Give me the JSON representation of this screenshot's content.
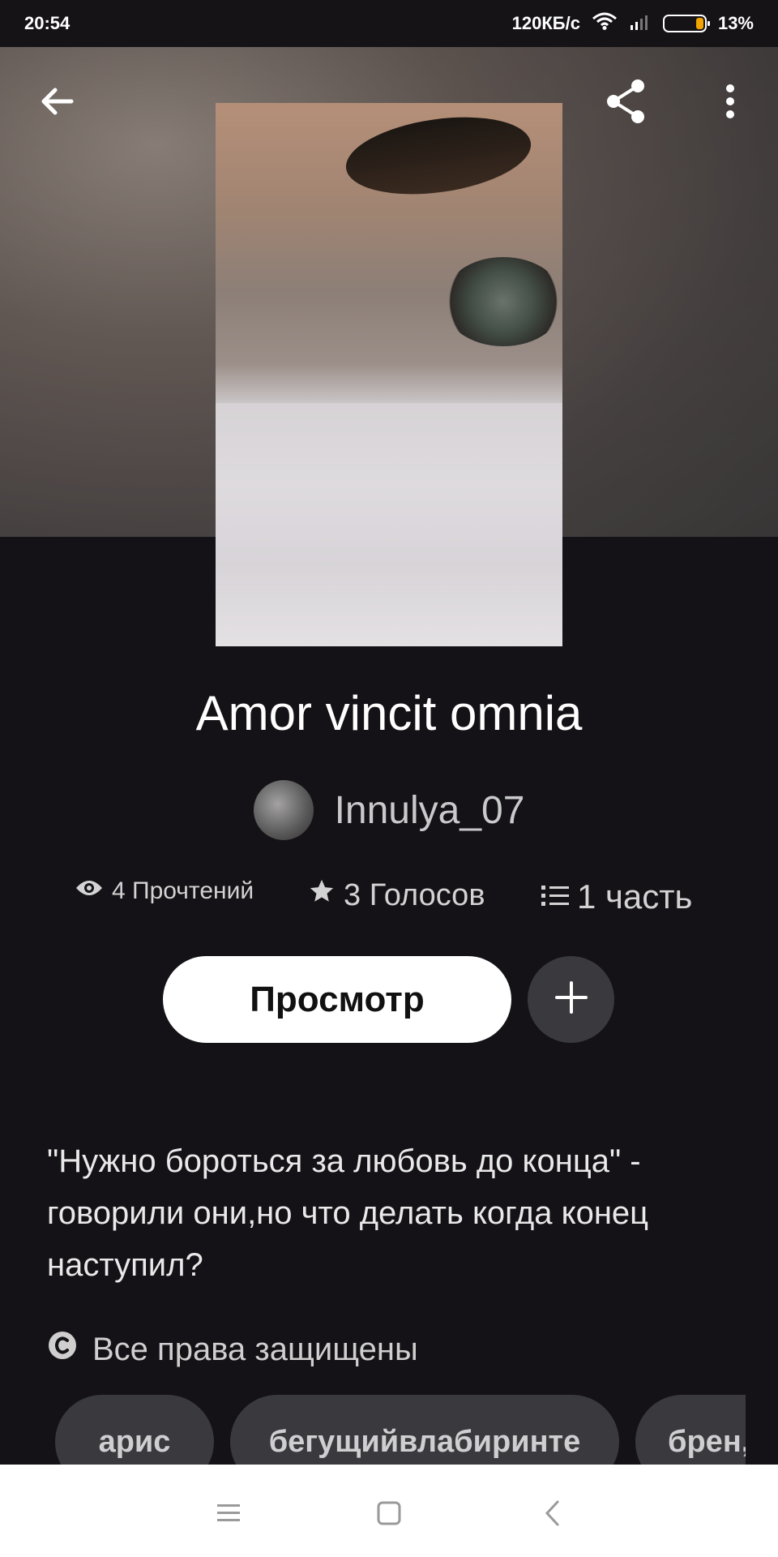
{
  "status_bar": {
    "time": "20:54",
    "network_speed": "120КБ/с",
    "battery_percent": "13%",
    "battery_level": 0.13,
    "icons": [
      "wifi-icon",
      "signal-icon",
      "battery-icon"
    ]
  },
  "top_bar": {
    "icons": [
      "back-arrow-icon",
      "share-icon",
      "more-vertical-icon"
    ]
  },
  "story": {
    "title": "Amor vincit omnia",
    "author": "Innulya_07",
    "stats": {
      "reads": "4 Прочтений",
      "votes": "3 Голосов",
      "parts": "1 часть"
    },
    "read_button": "Просмотр",
    "description": "\"Нужно бороться за любовь до конца\" - говорили они,но что делать когда конец наступил?",
    "copyright": "Все права защищены",
    "tags": [
      "арис",
      "бегущийвлабиринте",
      "брен,"
    ]
  },
  "nav_bar": {
    "icons": [
      "menu-icon",
      "home-square-icon",
      "back-chevron-icon"
    ]
  },
  "colors": {
    "background": "#141216",
    "button_primary": "#ffffff",
    "tag_background": "#3a393d",
    "battery_accent": "#f0a400"
  }
}
